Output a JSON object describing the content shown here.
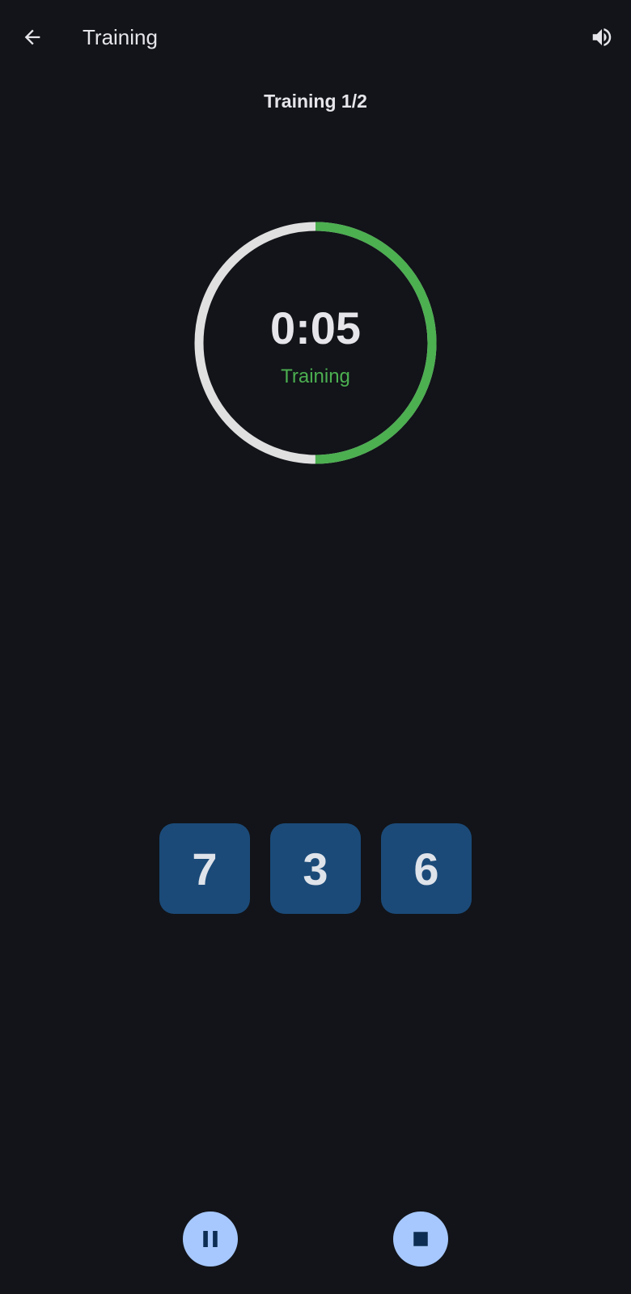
{
  "appbar": {
    "title": "Training",
    "back_icon": "arrow-back-icon",
    "volume_icon": "volume-up-icon"
  },
  "round": {
    "label": "Training 1/2"
  },
  "timer": {
    "time": "0:05",
    "phase": "Training",
    "progress": 0.5,
    "progress_color": "#4caf50",
    "track_color": "#e0e0e0"
  },
  "digits": [
    "7",
    "3",
    "6"
  ],
  "controls": {
    "pause_icon": "pause-icon",
    "stop_icon": "stop-icon",
    "button_color": "#a6c8ff",
    "icon_color": "#0d2d52"
  },
  "colors": {
    "background": "#121419",
    "tile": "#1b4a78"
  }
}
